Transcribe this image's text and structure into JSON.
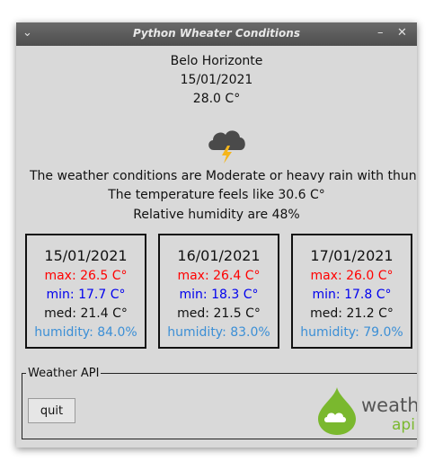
{
  "window": {
    "title": "Python Wheater Conditions",
    "menu_icon": "chevron-down-icon",
    "minimize_icon": "minimize-icon",
    "close_icon": "close-icon"
  },
  "current": {
    "city": "Belo Horizonte",
    "date": "15/01/2021",
    "temperature": "28.0 C°",
    "icon": "storm-cloud-icon",
    "conditions": "The weather conditions are Moderate or heavy rain with thunder",
    "feels_like": "The temperature feels like 30.6 C°",
    "humidity": "Relative humidity are 48%"
  },
  "forecast": [
    {
      "date": "15/01/2021",
      "max": "max: 26.5 C°",
      "min": "min: 17.7 C°",
      "med": "med: 21.4 C°",
      "humidity": "humidity: 84.0%"
    },
    {
      "date": "16/01/2021",
      "max": "max: 26.4 C°",
      "min": "min: 18.3 C°",
      "med": "med: 21.5 C°",
      "humidity": "humidity: 83.0%"
    },
    {
      "date": "17/01/2021",
      "max": "max: 26.0 C°",
      "min": "min: 17.8 C°",
      "med": "med: 21.2 C°",
      "humidity": "humidity: 79.0%"
    }
  ],
  "api_panel": {
    "label": "Weather API",
    "quit_label": "quit",
    "logo_text": "weather",
    "logo_subtext": "api"
  },
  "colors": {
    "max": "#ff0000",
    "min": "#0000ee",
    "humidity": "#3c8fd6",
    "logo_green": "#7ab82e"
  }
}
